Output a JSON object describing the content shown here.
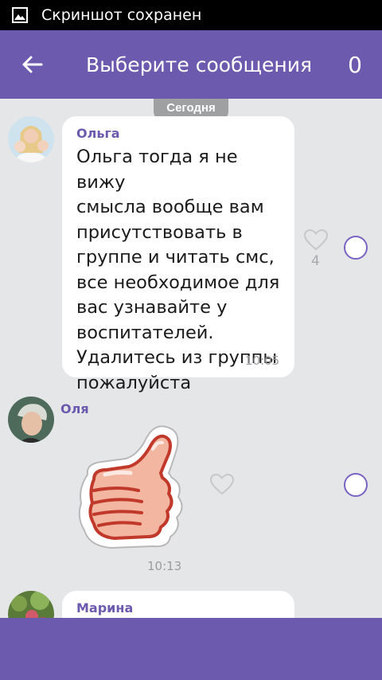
{
  "status_bar": {
    "icon": "image-icon",
    "text": "Скриншот сохранен"
  },
  "toolbar": {
    "back_icon": "arrow-left-icon",
    "title": "Выберите сообщения",
    "selected_count": "0"
  },
  "chat": {
    "date_separator": "Сегодня",
    "messages": [
      {
        "sender": "Ольга",
        "text": "Ольга тогда я не вижу\nсмысла вообще вам\nприсутствовать в\nгруппе и читать смс,\nвсе необходимое для\nвас узнавайте у\nвоспитателей.\nУдалитесь из группы\nпожалуйста",
        "time": "10:05",
        "likes": "4",
        "selected": false
      },
      {
        "sender": "Оля",
        "sticker": "thumbs-up-sticker",
        "time": "10:13",
        "likes": "",
        "selected": false
      },
      {
        "sender": "Марина"
      }
    ]
  },
  "colors": {
    "accent": "#6c5aae",
    "background": "#e4e6e8",
    "bubble": "#ffffff",
    "date_chip": "#9ea0a2"
  }
}
